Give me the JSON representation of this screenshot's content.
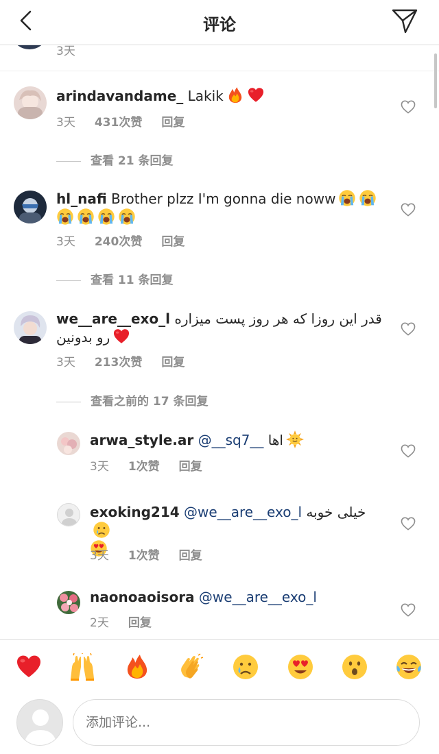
{
  "header": {
    "title": "评论",
    "back_icon": "chevron-left-icon",
    "send_icon": "paper-plane-icon"
  },
  "previous": {
    "time": "3天"
  },
  "comments": [
    {
      "username": "arindavandame_",
      "text": "Lakik",
      "emojis": [
        "fire",
        "red-heart"
      ],
      "time": "3天",
      "likes": "431次赞",
      "reply": "回复",
      "view_replies": "查看 21 条回复"
    },
    {
      "username": "hl_nafi",
      "text": "Brother plzz I'm gonna die noww",
      "emojis": [
        "loudly-crying",
        "loudly-crying",
        "loudly-crying",
        "loudly-crying",
        "loudly-crying",
        "loudly-crying"
      ],
      "time": "3天",
      "likes": "240次赞",
      "reply": "回复",
      "view_replies": "查看 11 条回复"
    },
    {
      "username": "we__are__exo_l",
      "text": "قدر این روزا که هر روز پست میزاره رو بدونین",
      "emojis": [
        "red-heart"
      ],
      "time": "3天",
      "likes": "213次赞",
      "reply": "回复",
      "view_replies": "查看之前的 17 条回复"
    }
  ],
  "replies": [
    {
      "username": "arwa_style.ar",
      "mention": "@__sq7__",
      "text": "اها",
      "emojis": [
        "sun-with-face"
      ],
      "time": "3天",
      "likes": "1次赞",
      "reply": "回复"
    },
    {
      "username": "exoking214",
      "mention": "@we__are__exo_l",
      "text": "خیلی خوبه",
      "emojis": [
        "crying-face",
        "heart-eyes"
      ],
      "time": "3天",
      "likes": "1次赞",
      "reply": "回复"
    },
    {
      "username": "naonoaoisora",
      "mention": "@we__are__exo_l",
      "text": "",
      "emojis": [],
      "time": "2天",
      "reply": "回复"
    }
  ],
  "quick_emojis": [
    "red-heart",
    "raising-hands",
    "fire",
    "clapping-hands",
    "crying-face",
    "heart-eyes",
    "open-mouth",
    "tears-of-joy"
  ],
  "composer": {
    "placeholder": "添加评论..."
  },
  "colors": {
    "text": "#262626",
    "secondary": "#8e8e8e",
    "mention": "#1a3d73",
    "divider": "#dbdbdb"
  }
}
